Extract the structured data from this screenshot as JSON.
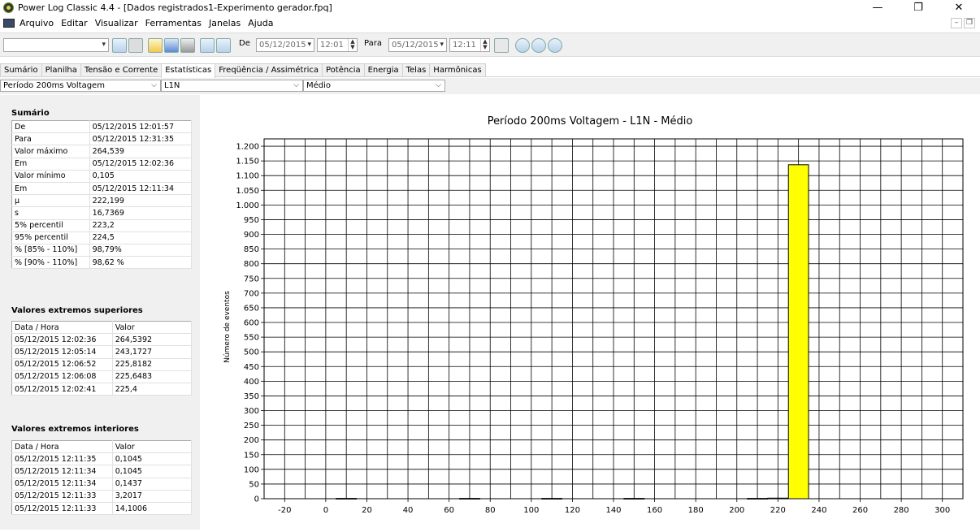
{
  "window": {
    "title": "Power Log Classic 4.4 - [Dados registrados1-Experimento gerador.fpq]",
    "minimize": "—",
    "maximize": "❐",
    "close": "✕"
  },
  "menu": [
    "Arquivo",
    "Editar",
    "Visualizar",
    "Ferramentas",
    "Janelas",
    "Ajuda"
  ],
  "toolbar": {
    "de_label": "De",
    "de_date": "05/12/2015",
    "de_time": "12:01",
    "para_label": "Para",
    "para_date": "05/12/2015",
    "para_time": "12:11"
  },
  "tabs": [
    "Sumário",
    "Planilha",
    "Tensão e Corrente",
    "Estatísticas",
    "Freqüência / Assimétrica",
    "Potência",
    "Energia",
    "Telas",
    "Harmônicas"
  ],
  "active_tab": "Estatísticas",
  "selectors": {
    "parameter": "Período 200ms Voltagem",
    "phase": "L1N",
    "mode": "Médio"
  },
  "summary": {
    "title": "Sumário",
    "rows": [
      [
        "De",
        "05/12/2015 12:01:57"
      ],
      [
        "Para",
        "05/12/2015 12:31:35"
      ],
      [
        "Valor máximo",
        "264,539"
      ],
      [
        "Em",
        "05/12/2015 12:02:36"
      ],
      [
        "Valor mínimo",
        "0,105"
      ],
      [
        "Em",
        "05/12/2015 12:11:34"
      ],
      [
        "μ",
        "222,199"
      ],
      [
        "s",
        "16,7369"
      ],
      [
        "5% percentil",
        "223,2"
      ],
      [
        "95% percentil",
        "224,5"
      ],
      [
        "% [85% - 110%]",
        "98,79%"
      ],
      [
        "% [90% - 110%]",
        "98,62 %"
      ]
    ]
  },
  "upper_extremes": {
    "title": "Valores extremos superiores",
    "header": [
      "Data / Hora",
      "Valor"
    ],
    "rows": [
      [
        "05/12/2015 12:02:36",
        "264,5392"
      ],
      [
        "05/12/2015 12:05:14",
        "243,1727"
      ],
      [
        "05/12/2015 12:06:52",
        "225,8182"
      ],
      [
        "05/12/2015 12:06:08",
        "225,6483"
      ],
      [
        "05/12/2015 12:02:41",
        "225,4"
      ]
    ]
  },
  "lower_extremes": {
    "title": "Valores extremos interiores",
    "header": [
      "Data / Hora",
      "Valor"
    ],
    "rows": [
      [
        "05/12/2015 12:11:35",
        "0,1045"
      ],
      [
        "05/12/2015 12:11:34",
        "0,1045"
      ],
      [
        "05/12/2015 12:11:34",
        "0,1437"
      ],
      [
        "05/12/2015 12:11:33",
        "3,2017"
      ],
      [
        "05/12/2015 12:11:33",
        "14,1006"
      ]
    ]
  },
  "chart_data": {
    "type": "bar",
    "title": "Período 200ms Voltagem  -  L1N  -  Médio",
    "xlabel": "",
    "ylabel": "Número de eventos",
    "xlim": [
      -30,
      310
    ],
    "ylim": [
      0,
      1225
    ],
    "x_ticks": [
      -20,
      0,
      20,
      40,
      60,
      80,
      100,
      120,
      140,
      160,
      180,
      200,
      220,
      240,
      260,
      280,
      300
    ],
    "y_ticks": [
      0,
      50,
      100,
      150,
      200,
      250,
      300,
      350,
      400,
      450,
      500,
      550,
      600,
      650,
      700,
      750,
      800,
      850,
      900,
      950,
      1000,
      1050,
      1100,
      1150,
      1200
    ],
    "y_tick_labels": [
      "0",
      "50",
      "100",
      "150",
      "200",
      "250",
      "300",
      "350",
      "400",
      "450",
      "500",
      "550",
      "600",
      "650",
      "700",
      "750",
      "800",
      "850",
      "900",
      "950",
      "1.000",
      "1.050",
      "1.100",
      "1.150",
      "1.200"
    ],
    "grid": true,
    "bar_color": "#ffff00",
    "bins": [
      {
        "x": 10,
        "value": 1
      },
      {
        "x": 70,
        "value": 1
      },
      {
        "x": 110,
        "value": 1
      },
      {
        "x": 150,
        "value": 1
      },
      {
        "x": 210,
        "value": 1
      },
      {
        "x": 220,
        "value": 2
      },
      {
        "x": 230,
        "value": 1137
      }
    ]
  }
}
